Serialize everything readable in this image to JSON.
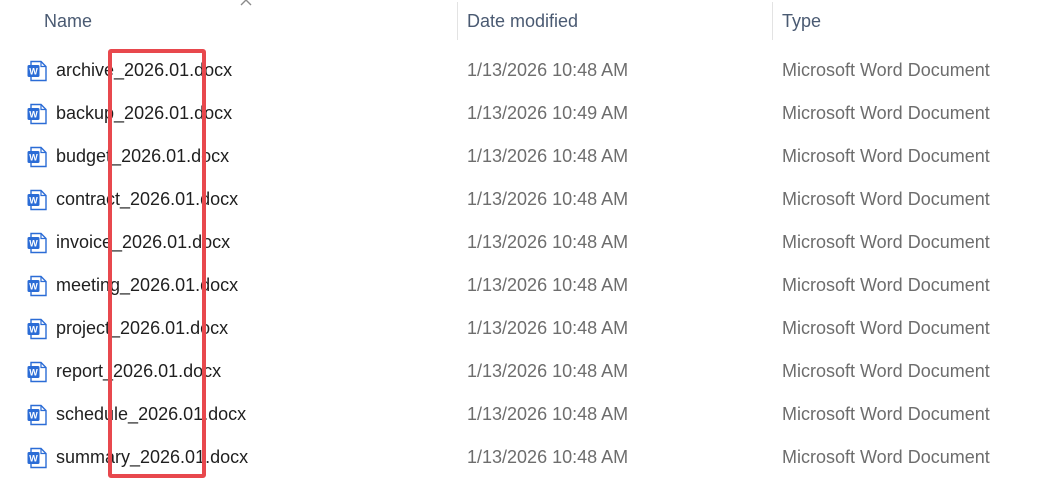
{
  "columns": {
    "name": "Name",
    "date_modified": "Date modified",
    "type": "Type"
  },
  "sort": {
    "column": "name",
    "direction": "ascending",
    "icon": "chevron-up-icon"
  },
  "file_icon": "word-document-icon",
  "accent_colors": {
    "word_blue": "#2b6cd6",
    "highlight_red": "#e8484d"
  },
  "files": [
    {
      "name": "archive_2026.01.docx",
      "date": "1/13/2026 10:48 AM",
      "type": "Microsoft Word Document"
    },
    {
      "name": "backup_2026.01.docx",
      "date": "1/13/2026 10:49 AM",
      "type": "Microsoft Word Document"
    },
    {
      "name": "budget_2026.01.docx",
      "date": "1/13/2026 10:48 AM",
      "type": "Microsoft Word Document"
    },
    {
      "name": "contract_2026.01.docx",
      "date": "1/13/2026 10:48 AM",
      "type": "Microsoft Word Document"
    },
    {
      "name": "invoice_2026.01.docx",
      "date": "1/13/2026 10:48 AM",
      "type": "Microsoft Word Document"
    },
    {
      "name": "meeting_2026.01.docx",
      "date": "1/13/2026 10:48 AM",
      "type": "Microsoft Word Document"
    },
    {
      "name": "project_2026.01.docx",
      "date": "1/13/2026 10:48 AM",
      "type": "Microsoft Word Document"
    },
    {
      "name": "report_2026.01.docx",
      "date": "1/13/2026 10:48 AM",
      "type": "Microsoft Word Document"
    },
    {
      "name": "schedule_2026.01.docx",
      "date": "1/13/2026 10:48 AM",
      "type": "Microsoft Word Document"
    },
    {
      "name": "summary_2026.01.docx",
      "date": "1/13/2026 10:48 AM",
      "type": "Microsoft Word Document"
    }
  ]
}
